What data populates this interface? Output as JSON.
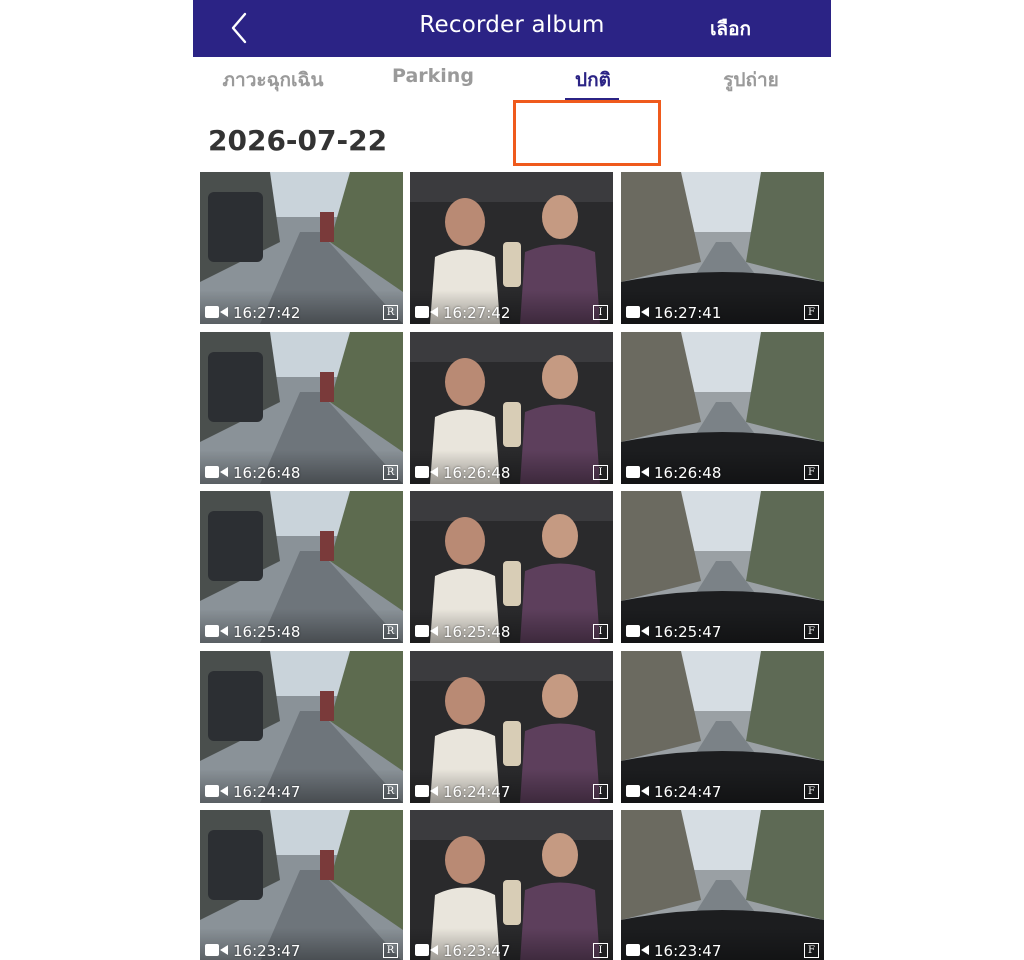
{
  "header": {
    "title": "Recorder album",
    "select_label": "เลือก"
  },
  "tabs": [
    {
      "label": "ภาวะฉุกเฉิน",
      "active": false
    },
    {
      "label": "Parking",
      "active": false
    },
    {
      "label": "ปกติ",
      "active": true
    },
    {
      "label": "รูปถ่าย",
      "active": false
    }
  ],
  "date": "2026-07-22",
  "colors": {
    "header_bg": "#2b2385",
    "active_tab": "#2b2385",
    "inactive_tab": "#9a9a9a",
    "highlight_box": "#ef5a1c"
  },
  "videos": [
    {
      "time": "16:27:42",
      "badge": "R",
      "scene": "rear-street"
    },
    {
      "time": "16:27:42",
      "badge": "I",
      "scene": "interior"
    },
    {
      "time": "16:27:41",
      "badge": "F",
      "scene": "front-dash"
    },
    {
      "time": "16:26:48",
      "badge": "R",
      "scene": "rear-street"
    },
    {
      "time": "16:26:48",
      "badge": "I",
      "scene": "interior"
    },
    {
      "time": "16:26:48",
      "badge": "F",
      "scene": "front-dash"
    },
    {
      "time": "16:25:48",
      "badge": "R",
      "scene": "rear-street"
    },
    {
      "time": "16:25:48",
      "badge": "I",
      "scene": "interior"
    },
    {
      "time": "16:25:47",
      "badge": "F",
      "scene": "front-dash"
    },
    {
      "time": "16:24:47",
      "badge": "R",
      "scene": "rear-street"
    },
    {
      "time": "16:24:47",
      "badge": "I",
      "scene": "interior"
    },
    {
      "time": "16:24:47",
      "badge": "F",
      "scene": "front-dash"
    },
    {
      "time": "16:23:47",
      "badge": "R",
      "scene": "rear-street"
    },
    {
      "time": "16:23:47",
      "badge": "I",
      "scene": "interior"
    },
    {
      "time": "16:23:47",
      "badge": "F",
      "scene": "front-dash"
    }
  ]
}
